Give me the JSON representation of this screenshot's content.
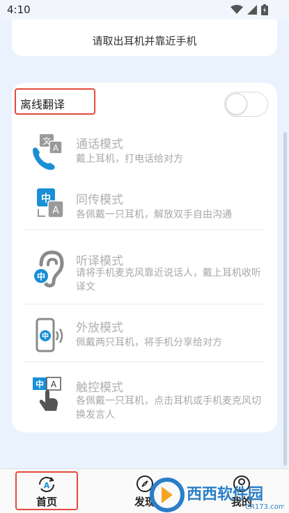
{
  "status_bar": {
    "time": "4:10"
  },
  "top_card": {
    "message": "请取出耳机并靠近手机"
  },
  "offline": {
    "label": "离线翻译",
    "enabled": false
  },
  "modes": [
    {
      "title": "通话模式",
      "desc": "戴上耳机，打电话给对方",
      "icon": "phone-translate-icon"
    },
    {
      "title": "同传模式",
      "desc": "各佩戴一只耳机，解放双手自由沟通",
      "icon": "simultaneous-translate-icon"
    },
    {
      "title": "听译模式",
      "desc": "请将手机麦克风靠近说话人，戴上耳机收听译文",
      "icon": "ear-listen-icon"
    },
    {
      "title": "外放模式",
      "desc": "佩戴两只耳机，将手机分享给对方",
      "icon": "speaker-phone-icon"
    },
    {
      "title": "触控模式",
      "desc": "各佩戴一只耳机，点击耳机或手机麦克风切换发言人",
      "icon": "touch-control-icon"
    }
  ],
  "icon_text": {
    "wen": "文",
    "a": "A",
    "zhong": "中"
  },
  "tabs": [
    {
      "label": "首页",
      "icon": "home-translate-icon",
      "active": true
    },
    {
      "label": "发现",
      "icon": "compass-icon",
      "active": false
    },
    {
      "label": "我的",
      "icon": "profile-icon",
      "active": false
    }
  ],
  "watermark": {
    "text": "西西软件园",
    "sub": "CR173.com"
  },
  "colors": {
    "accent": "#1a8fd6",
    "highlight_box": "#e24a3a",
    "background": "#e9f2fd"
  }
}
